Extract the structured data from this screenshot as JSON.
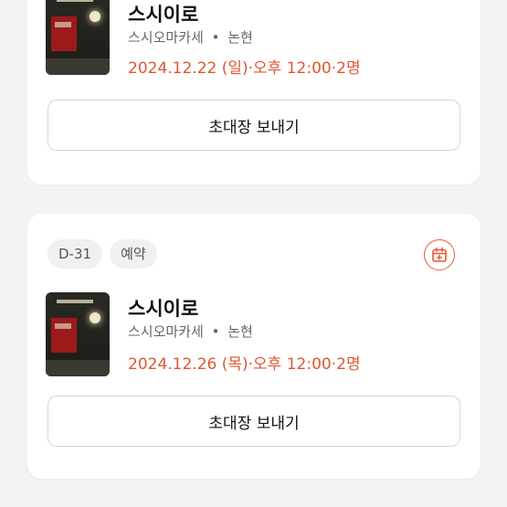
{
  "reservations": [
    {
      "restaurant": "스시이로",
      "category": "스시오마카세",
      "area": "논현",
      "datetime": "2024.12.22 (일)·오후 12:00·2명",
      "invite_label": "초대장 보내기"
    },
    {
      "dday": "D-31",
      "status": "예약",
      "restaurant": "스시이로",
      "category": "스시오마카세",
      "area": "논현",
      "datetime": "2024.12.26 (목)·오후 12:00·2명",
      "invite_label": "초대장 보내기"
    }
  ],
  "separator": "•",
  "icons": {
    "calendar": "calendar-add-icon"
  },
  "colors": {
    "accent": "#e0552f",
    "chip_bg": "#f0f0f2",
    "page_bg": "#f3f3f5"
  }
}
